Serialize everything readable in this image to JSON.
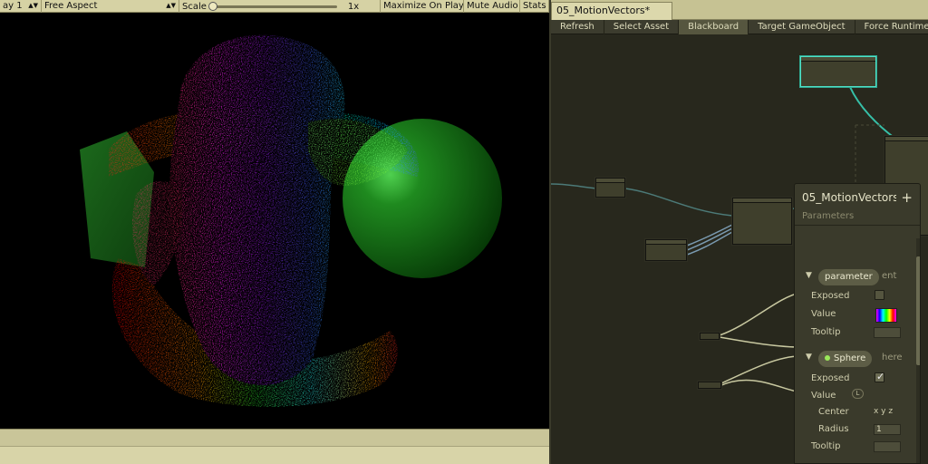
{
  "game_view": {
    "display_label": "ay 1",
    "aspect_label": "Free Aspect",
    "scale_label": "Scale",
    "scale_value": "1x",
    "maximize_label": "Maximize On Play",
    "mute_label": "Mute Audio",
    "stats_label": "Stats"
  },
  "editor": {
    "tab_title": "05_MotionVectors*",
    "toolbar": {
      "refresh": "Refresh",
      "select_asset": "Select Asset",
      "blackboard": "Blackboard",
      "target": "Target GameObject",
      "force_runtime": "Force Runtime M"
    }
  },
  "blackboard": {
    "title": "05_MotionVectors",
    "subtitle": "Parameters",
    "add_symbol": "+",
    "parameters": [
      {
        "name": "parameter",
        "type_suffix": "ent",
        "exposed_label": "Exposed",
        "exposed": false,
        "value_label": "Value",
        "tooltip_label": "Tooltip"
      },
      {
        "name": "Sphere",
        "type_suffix": "here",
        "exposed_label": "Exposed",
        "exposed": true,
        "value_label": "Value",
        "value_badge": "L",
        "center_label": "Center",
        "center_axes": "x y z",
        "radius_label": "Radius",
        "radius_value": "1",
        "tooltip_label": "Tooltip"
      }
    ]
  },
  "colors": {
    "toolbar_bg": "#d6d2a4",
    "editor_bg": "#28281d",
    "selection": "#4fe0c8",
    "sphere": "#1f7a1f",
    "cube": "#1a5c1a"
  }
}
